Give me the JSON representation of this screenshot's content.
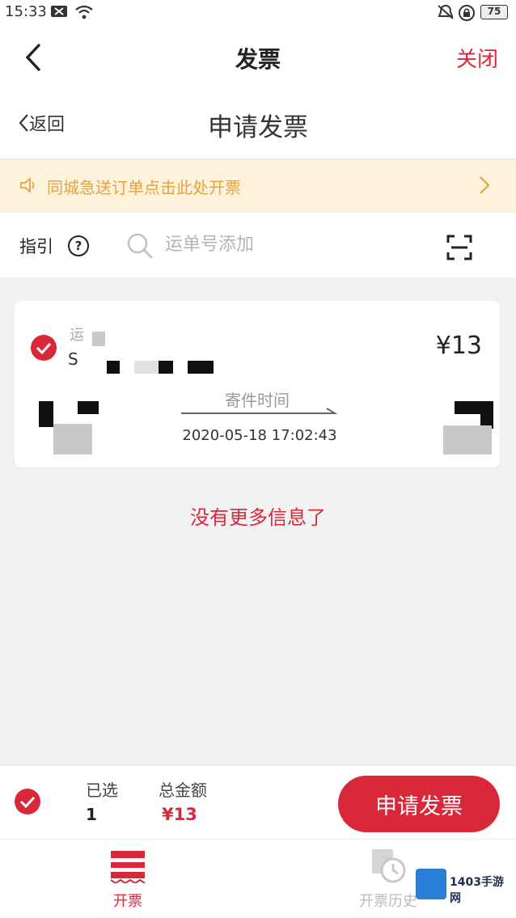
{
  "status_bar": {
    "time": "15:33",
    "battery": "75"
  },
  "nav": {
    "title": "发票",
    "close_label": "关闭"
  },
  "sub_header": {
    "back_label": "返回",
    "title": "申请发票"
  },
  "notice": {
    "text": "同城急送订单点击此处开票"
  },
  "search": {
    "guide_label": "指引",
    "help_symbol": "?",
    "placeholder": "运单号添加"
  },
  "order_card": {
    "label_top": "运",
    "label_bottom": "S",
    "price": "¥13",
    "time_label": "寄件时间",
    "send_time": "2020-05-18 17:02:43"
  },
  "no_more_text": "没有更多信息了",
  "bottom_bar": {
    "selected_label": "已选",
    "selected_count": "1",
    "total_label": "总金额",
    "total_amount": "¥13",
    "apply_label": "申请发票"
  },
  "tabs": [
    {
      "label": "开票",
      "active": true
    },
    {
      "label": "开票历史",
      "active": false
    }
  ],
  "watermark": {
    "text": "1403手游网"
  },
  "colors": {
    "accent": "#d9283a",
    "notice_bg": "#fdf3dc",
    "notice_text": "#e8a23a"
  },
  "icons": {
    "back": "chevron-left-icon",
    "notice": "speaker-icon",
    "search": "search-icon",
    "scan": "scan-icon",
    "check": "check-circle-icon",
    "invoice": "invoice-icon",
    "history": "history-icon"
  }
}
